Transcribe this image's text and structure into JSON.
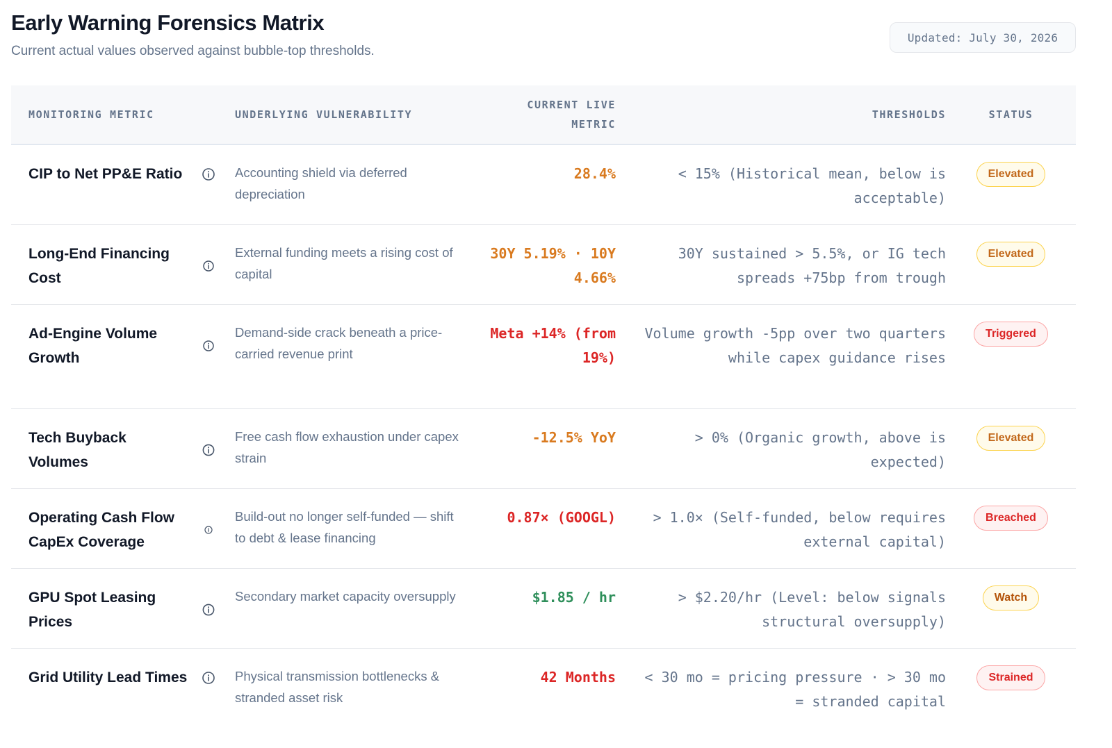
{
  "header": {
    "title": "Early Warning Forensics Matrix",
    "subtitle": "Current actual values observed against bubble-top thresholds.",
    "updated": "Updated: July 30, 2026"
  },
  "columns": {
    "metric": "Monitoring Metric",
    "vulnerability": "Underlying Vulnerability",
    "live_line1": "Current Live",
    "live_line2": "Metric",
    "thresholds": "Thresholds",
    "status": "Status"
  },
  "rows": [
    {
      "metric": "CIP to Net PP&E Ratio",
      "vulnerability": "Accounting shield via deferred depreciation",
      "live": "28.4%",
      "threshold": "< 15% (Historical mean, below is acceptable)",
      "status": "Elevated",
      "live_color": "#d97a1f"
    },
    {
      "metric": "Long-End Financing Cost",
      "vulnerability": "External funding meets a rising cost of capital",
      "live": "30Y 5.19% · 10Y 4.66%",
      "threshold": "30Y sustained > 5.5%, or IG tech spreads +75bp from trough",
      "status": "Elevated",
      "live_color": "#d97a1f"
    },
    {
      "metric": "Ad-Engine Volume Growth",
      "vulnerability": "Demand-side crack beneath a price-carried revenue print",
      "live": "Meta +14% (from 19%)",
      "threshold": "Volume growth -5pp over two quarters while capex guidance rises",
      "status": "Triggered",
      "live_color": "#dc2626"
    },
    {
      "metric": "Tech Buyback Volumes",
      "vulnerability": "Free cash flow exhaustion under capex strain",
      "live": "-12.5% YoY",
      "threshold": "> 0% (Organic growth, above is expected)",
      "status": "Elevated",
      "live_color": "#d97a1f"
    },
    {
      "metric": "Operating Cash Flow CapEx Coverage",
      "vulnerability": "Build-out no longer self-funded — shift to debt & lease financing",
      "live": "0.87× (GOOGL)",
      "threshold": "> 1.0× (Self-funded, below requires external capital)",
      "status": "Breached",
      "live_color": "#dc2626"
    },
    {
      "metric": "GPU Spot Leasing Prices",
      "vulnerability": "Secondary market capacity oversupply",
      "live": "$1.85 / hr",
      "threshold": "> $2.20/hr (Level: below signals structural oversupply)",
      "status": "Watch",
      "live_color": "#2f8f5b"
    },
    {
      "metric": "Grid Utility Lead Times",
      "vulnerability": "Physical transmission bottlenecks & stranded asset risk",
      "live": "42 Months",
      "threshold": "< 30 mo = pricing pressure · > 30 mo = stranded capital",
      "status": "Strained",
      "live_color": "#dc2626"
    }
  ],
  "colors": {
    "elevated": "#c2681a",
    "red": "#dc2626",
    "green": "#2f8f5b",
    "muted": "#64748b"
  },
  "icons": {
    "info": "info-circle-icon"
  }
}
